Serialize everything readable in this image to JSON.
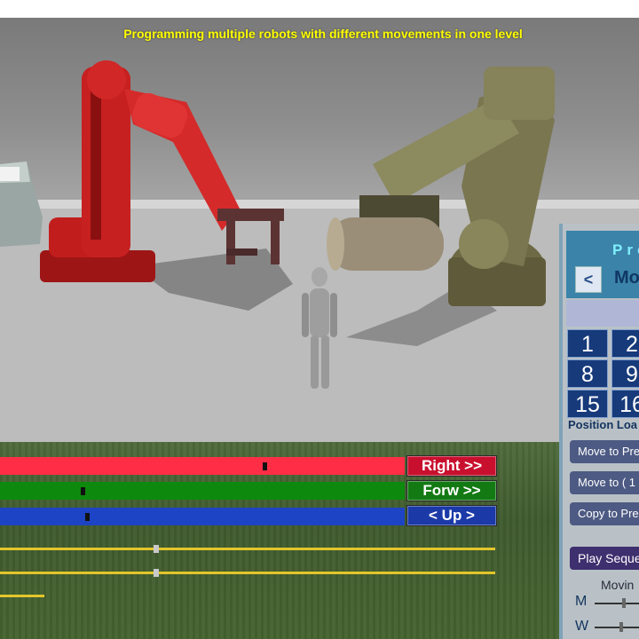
{
  "title": "Programming multiple robots with different movements in one level",
  "colors": {
    "right_bar": "#ff2d46",
    "forw_bar": "#0d8a0d",
    "up_bar": "#1d44c4",
    "right_btn": "#c8102e",
    "forw_btn": "#137a13",
    "up_btn": "#1b3aa8"
  },
  "axis_controls": [
    {
      "label": "Right >>",
      "value": 0.65
    },
    {
      "label": "Forw  >>",
      "value": 0.2
    },
    {
      "label": "< Up >",
      "value": 0.21
    }
  ],
  "speed_sliders": [
    {
      "value": 0.31
    },
    {
      "value": 0.31
    },
    {
      "value": 0.09
    }
  ],
  "panel": {
    "heading": "Pro",
    "back_button": "<",
    "label": "Mov",
    "number_buttons": [
      "1",
      "2",
      "8",
      "9",
      "15",
      "16"
    ],
    "position_label": "Position Loa",
    "buttons": {
      "move_to_pre": "Move to Pre",
      "move_to_1": "Move to ( 1",
      "copy_to_pre": "Copy to Pre",
      "play_sequence": "Play Seque"
    },
    "moving_label": "Movin",
    "slider_m": {
      "label": "M",
      "value": 0.62
    },
    "slider_w": {
      "label": "W",
      "value": 0.55
    }
  }
}
